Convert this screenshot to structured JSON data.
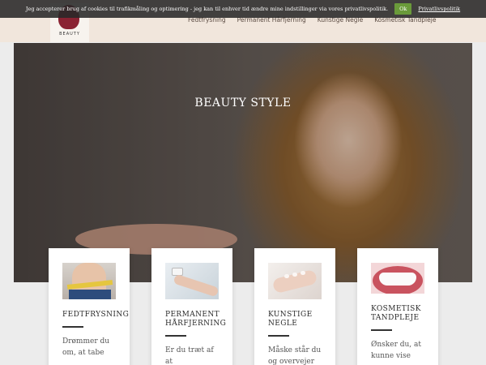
{
  "cookie": {
    "text": "Jeg accepterer brug af cookies til trafikmåling og optimering - jeg kan til enhver tid ændre mine indstillinger via vores privatlivspolitik.",
    "ok_label": "Ok",
    "policy_link": "Privatlivspolitik"
  },
  "header": {
    "logo_text": "BEAUTY",
    "nav": [
      "Fedtfrysning",
      "Permanent Hårfjerning",
      "Kunstige Negle",
      "Kosmetisk Tandpleje"
    ]
  },
  "hero": {
    "title": "BEAUTY STYLE"
  },
  "cards": [
    {
      "title": "FEDTFRYSNING",
      "text": "Drømmer du om, at tabe"
    },
    {
      "title": "PERMANENT HÅRFJERNING",
      "text": "Er du træt af at"
    },
    {
      "title": "KUNSTIGE NEGLE",
      "text": "Måske står du og overvejer"
    },
    {
      "title": "KOSMETISK TANDPLEJE",
      "text": "Ønsker du, at kunne vise"
    }
  ],
  "colors": {
    "header_bg": "#f1e6dc",
    "accent_logo": "#8a2232",
    "cookie_ok": "#6a9a3a"
  }
}
